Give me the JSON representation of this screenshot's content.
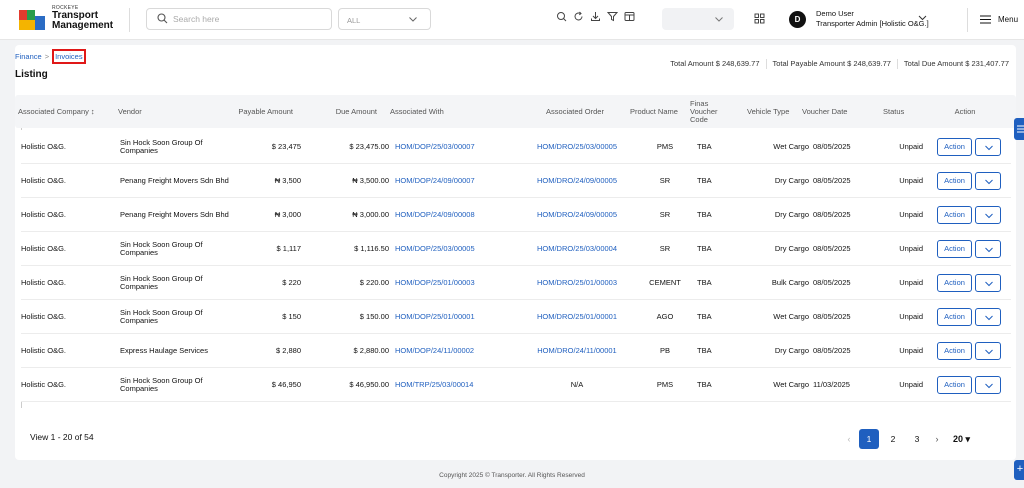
{
  "header": {
    "brand_small": "ROCKEYE",
    "brand_line1": "Transport",
    "brand_line2": "Management",
    "search_placeholder": "Search here",
    "filter_value": "ALL",
    "user_name": "Demo User",
    "user_role": "Transporter Admin [Holistic O&G.]",
    "avatar_letter": "D",
    "menu_label": "Menu"
  },
  "breadcrumb": {
    "parent": "Finance",
    "current": "Invoices"
  },
  "page_title": "Listing",
  "totals": {
    "total_amount": "Total Amount  $ 248,639.77",
    "total_payable": "Total Payable Amount  $ 248,639.77",
    "total_due": "Total Due Amount  $ 231,407.77"
  },
  "table": {
    "headers": {
      "company": "Associated Company",
      "vendor": "Vendor",
      "payable": "Payable Amount",
      "due": "Due Amount",
      "assoc_with": "Associated With",
      "assoc_order": "Associated Order",
      "product": "Product Name",
      "voucher_code": "Finas Voucher Code",
      "vehicle": "Vehicle Type",
      "voucher_date": "Voucher Date",
      "status": "Status",
      "action": "Action"
    },
    "rows": [
      {
        "company": "Holistic O&G.",
        "vendor": "Sin Hock Soon Group Of Companies",
        "payable": "$ 23,475",
        "due": "$ 23,475.00",
        "assoc_with": "HOM/DOP/25/03/00007",
        "assoc_order": "HOM/DRO/25/03/00005",
        "product": "PMS",
        "voucher_code": "TBA",
        "vehicle": "Wet Cargo",
        "voucher_date": "08/05/2025",
        "status": "Unpaid",
        "action": "Action"
      },
      {
        "company": "Holistic O&G.",
        "vendor": "Penang Freight Movers Sdn Bhd",
        "payable": "₦ 3,500",
        "due": "₦ 3,500.00",
        "assoc_with": "HOM/DOP/24/09/00007",
        "assoc_order": "HOM/DRO/24/09/00005",
        "product": "SR",
        "voucher_code": "TBA",
        "vehicle": "Dry Cargo",
        "voucher_date": "08/05/2025",
        "status": "Unpaid",
        "action": "Action"
      },
      {
        "company": "Holistic O&G.",
        "vendor": "Penang Freight Movers Sdn Bhd",
        "payable": "₦ 3,000",
        "due": "₦ 3,000.00",
        "assoc_with": "HOM/DOP/24/09/00008",
        "assoc_order": "HOM/DRO/24/09/00005",
        "product": "SR",
        "voucher_code": "TBA",
        "vehicle": "Dry Cargo",
        "voucher_date": "08/05/2025",
        "status": "Unpaid",
        "action": "Action"
      },
      {
        "company": "Holistic O&G.",
        "vendor": "Sin Hock Soon Group Of Companies",
        "payable": "$ 1,117",
        "due": "$ 1,116.50",
        "assoc_with": "HOM/DOP/25/03/00005",
        "assoc_order": "HOM/DRO/25/03/00004",
        "product": "SR",
        "voucher_code": "TBA",
        "vehicle": "Dry Cargo",
        "voucher_date": "08/05/2025",
        "status": "Unpaid",
        "action": "Action"
      },
      {
        "company": "Holistic O&G.",
        "vendor": "Sin Hock Soon Group Of Companies",
        "payable": "$ 220",
        "due": "$ 220.00",
        "assoc_with": "HOM/DOP/25/01/00003",
        "assoc_order": "HOM/DRO/25/01/00003",
        "product": "CEMENT",
        "voucher_code": "TBA",
        "vehicle": "Bulk Cargo",
        "voucher_date": "08/05/2025",
        "status": "Unpaid",
        "action": "Action"
      },
      {
        "company": "Holistic O&G.",
        "vendor": "Sin Hock Soon Group Of Companies",
        "payable": "$ 150",
        "due": "$ 150.00",
        "assoc_with": "HOM/DOP/25/01/00001",
        "assoc_order": "HOM/DRO/25/01/00001",
        "product": "AGO",
        "voucher_code": "TBA",
        "vehicle": "Wet Cargo",
        "voucher_date": "08/05/2025",
        "status": "Unpaid",
        "action": "Action"
      },
      {
        "company": "Holistic O&G.",
        "vendor": "Express Haulage Services",
        "payable": "$ 2,880",
        "due": "$ 2,880.00",
        "assoc_with": "HOM/DOP/24/11/00002",
        "assoc_order": "HOM/DRO/24/11/00001",
        "product": "PB",
        "voucher_code": "TBA",
        "vehicle": "Dry Cargo",
        "voucher_date": "08/05/2025",
        "status": "Unpaid",
        "action": "Action"
      },
      {
        "company": "Holistic O&G.",
        "vendor": "Sin Hock Soon Group Of Companies",
        "payable": "$ 46,950",
        "due": "$ 46,950.00",
        "assoc_with": "HOM/TRP/25/03/00014",
        "assoc_order": "N/A",
        "product": "PMS",
        "voucher_code": "TBA",
        "vehicle": "Wet Cargo",
        "voucher_date": "11/03/2025",
        "status": "Unpaid",
        "action": "Action"
      }
    ]
  },
  "pagination": {
    "view_text": "View 1 - 20 of 54",
    "pages": [
      "1",
      "2",
      "3"
    ],
    "current": "1",
    "page_size": "20"
  },
  "footer": {
    "copyright": "Copyright 2025 © Transporter. All Rights Reserved"
  },
  "colors": {
    "accent": "#1f5fbf",
    "highlight_border": "#e01818"
  },
  "icons": [
    "search-icon",
    "chevron-down-icon",
    "refresh-icon",
    "download-icon",
    "filter-icon",
    "columns-icon",
    "grid-icon",
    "hamburger-icon"
  ]
}
